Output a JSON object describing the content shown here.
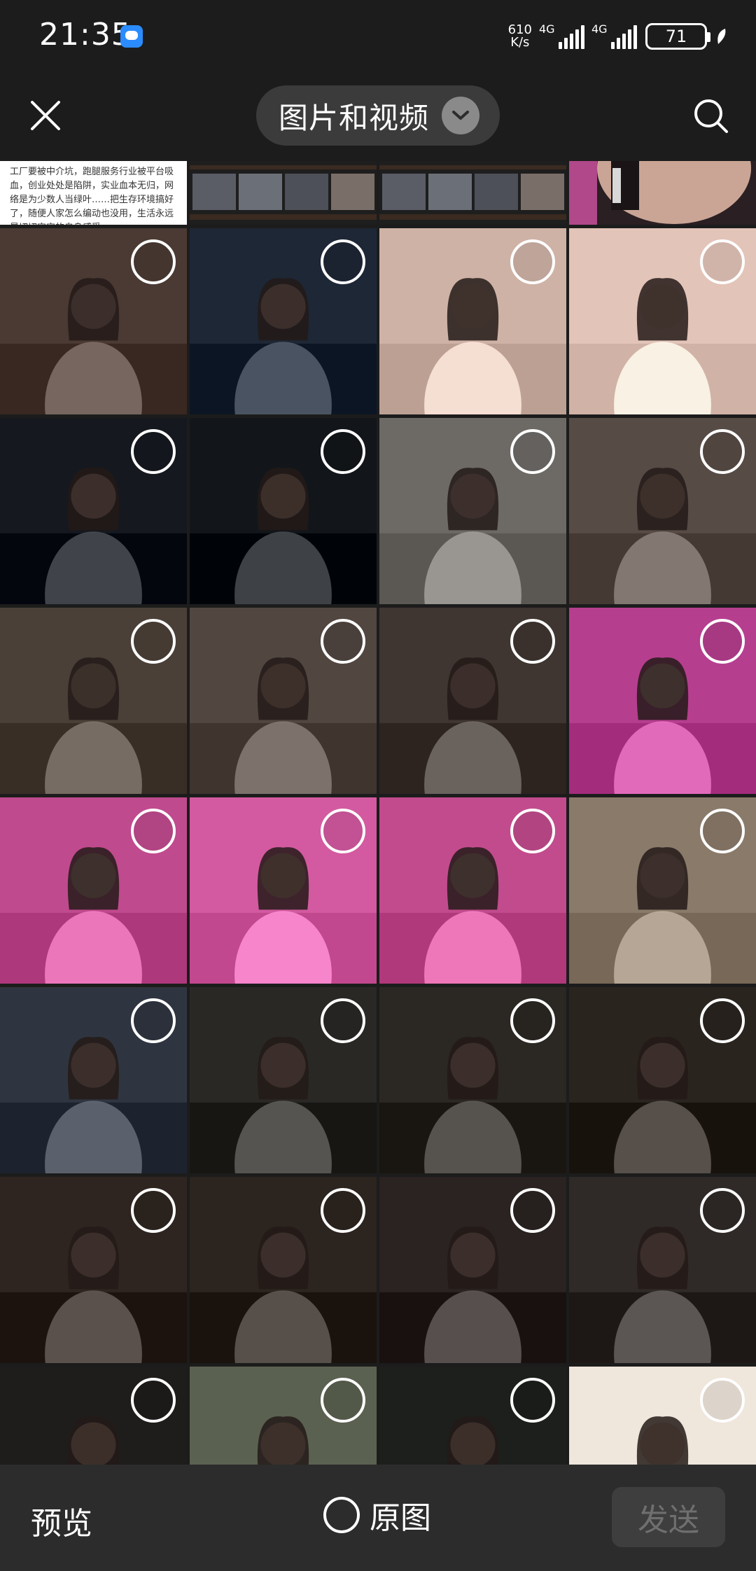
{
  "status_bar": {
    "time": "21:35",
    "net_speed_value": "610",
    "net_speed_unit": "K/s",
    "signal1_label": "4G",
    "signal2_label": "4G",
    "battery_level": "71"
  },
  "header": {
    "title": "图片和视频"
  },
  "top_strip": {
    "text": "工厂要被中介坑，跑腿服务行业被平台吸血，创业处处是陷阱，实业血本无归，网络是为少数人当绿叶……把生存环境搞好了，随便人家怎么编动也没用，生活永远是切切实实的自身感受"
  },
  "photo_tiles": [
    {
      "subject": "eye-closeup",
      "bg": "#4a3a33"
    },
    {
      "subject": "profile-red-lips",
      "bg": "#1e2736"
    },
    {
      "subject": "eye-makeup",
      "bg": "#cfb2a6"
    },
    {
      "subject": "eye-makeup-cheek",
      "bg": "#e3c4b8"
    },
    {
      "subject": "two-girls-night",
      "bg": "#15181f"
    },
    {
      "subject": "girl-night-hoodie",
      "bg": "#12161a"
    },
    {
      "subject": "cafe-storefront",
      "bg": "#6d6a66"
    },
    {
      "subject": "girl-cafe-interior",
      "bg": "#574b45"
    },
    {
      "subject": "girl-pink-sweater",
      "bg": "#4b4038"
    },
    {
      "subject": "girl-cafe-table",
      "bg": "#514640"
    },
    {
      "subject": "two-girls-table",
      "bg": "#3f3631"
    },
    {
      "subject": "graffiti-wall-girl",
      "bg": "#b63e8f"
    },
    {
      "subject": "graffiti-wall-girl-2",
      "bg": "#c04a8e"
    },
    {
      "subject": "graffiti-wall-girl-3",
      "bg": "#d35aa0"
    },
    {
      "subject": "graffiti-wall-girl-4",
      "bg": "#c24b8d"
    },
    {
      "subject": "couple-street",
      "bg": "#8a7a6a"
    },
    {
      "subject": "bear-storefront",
      "bg": "#2f3540"
    },
    {
      "subject": "girl-white-cap",
      "bg": "#2a2825"
    },
    {
      "subject": "girl-white-cap-2",
      "bg": "#2b2722"
    },
    {
      "subject": "girl-blue-cardigan",
      "bg": "#2a241f"
    },
    {
      "subject": "girl-blue-cardigan-2",
      "bg": "#2e2520"
    },
    {
      "subject": "girl-blue-cardigan-3",
      "bg": "#2c241f"
    },
    {
      "subject": "girl-blue-cardigan-4",
      "bg": "#2a2321"
    },
    {
      "subject": "girl-white-tshirt",
      "bg": "#2f2a27"
    },
    {
      "subject": "girl-hat-night",
      "bg": "#1f1d1c"
    },
    {
      "subject": "street-trees",
      "bg": "#5b6150"
    },
    {
      "subject": "street-night",
      "bg": "#1d1f1c"
    },
    {
      "subject": "girl-bright-room",
      "bg": "#efe6dc"
    }
  ],
  "bottom_bar": {
    "preview_label": "预览",
    "original_label": "原图",
    "send_label": "发送"
  },
  "colors": {
    "background": "#1c1c1c",
    "bottom_bar": "#2c2c2c",
    "send_disabled_bg": "#3e3e3e",
    "send_disabled_text": "#6f6f6f"
  }
}
